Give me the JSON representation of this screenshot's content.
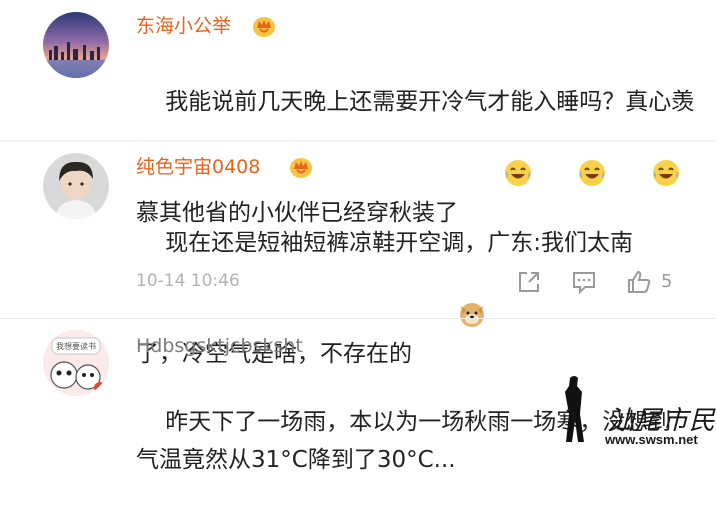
{
  "comments": [
    {
      "username": "东海小公举",
      "text": "我能说前几天晚上还需要开冷气才能入睡吗？真心羡慕其他省的小伙伴已经穿秋装了",
      "emojis": [
        "laugh-cry-icon",
        "laugh-cry-icon",
        "laugh-cry-icon"
      ]
    },
    {
      "username": "纯色宇宙0408",
      "text": "现在还是短袖短裤凉鞋开空调，广东:我们太南了，冷空气是啥，不存在的",
      "emoji": "doge-icon",
      "timestamp": "10-14 10:46",
      "like_count": "5"
    },
    {
      "username": "Hdbsgsktjcbsksht",
      "avatar_caption": "我想要读书",
      "text": "昨天下了一场雨，本以为一场秋雨一场寒，没想到气温竟然从31°C降到了30°C..."
    }
  ],
  "watermark": {
    "name": "汕尾市民网",
    "url": "www.swsm.net"
  },
  "colors": {
    "vip_name": "#e8631b",
    "plain_name": "#7a7a7a",
    "body_text": "#222222",
    "meta": "#b2b2b2"
  }
}
